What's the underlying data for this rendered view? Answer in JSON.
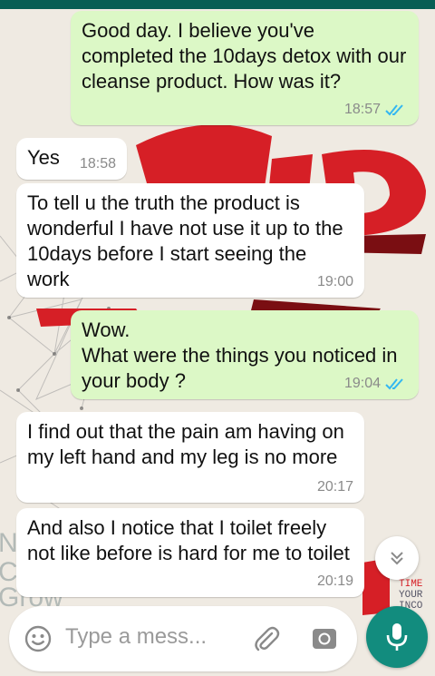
{
  "colors": {
    "header": "#075e54",
    "outgoing_bubble": "#dcf8c6",
    "incoming_bubble": "#ffffff",
    "read_ticks": "#34b7f1",
    "mic_button": "#128c7e"
  },
  "wallpaper": {
    "left_text": "N\nC\nGrow",
    "right_text": "EN\nTIME\nYOUR\nINCO"
  },
  "messages": [
    {
      "direction": "outgoing",
      "text": "Good day. I believe you've completed the 10days detox with our cleanse product. How was it?",
      "time": "18:57",
      "status_icon": "double-check-read-icon"
    },
    {
      "direction": "incoming",
      "text": "Yes",
      "time": "18:58"
    },
    {
      "direction": "incoming",
      "text": "To tell u the truth the product is wonderful I have not use it up to the 10days before I start seeing the work",
      "time": "19:00"
    },
    {
      "direction": "outgoing",
      "text": "Wow.\nWhat were the things you noticed in your body ?",
      "time": "19:04",
      "status_icon": "double-check-read-icon"
    },
    {
      "direction": "incoming",
      "text": "I find out that the pain am having on my left hand and my leg is no more",
      "time": "20:17"
    },
    {
      "direction": "incoming",
      "text": "And also I notice that I toilet freely not like before is hard for me to toilet",
      "time": "20:19"
    }
  ],
  "composer": {
    "placeholder": "Type a mess...",
    "emoji_icon": "emoji-icon",
    "attach_icon": "paperclip-icon",
    "camera_icon": "camera-icon",
    "mic_icon": "microphone-icon"
  },
  "scroll_button_icon": "double-chevron-down-icon"
}
